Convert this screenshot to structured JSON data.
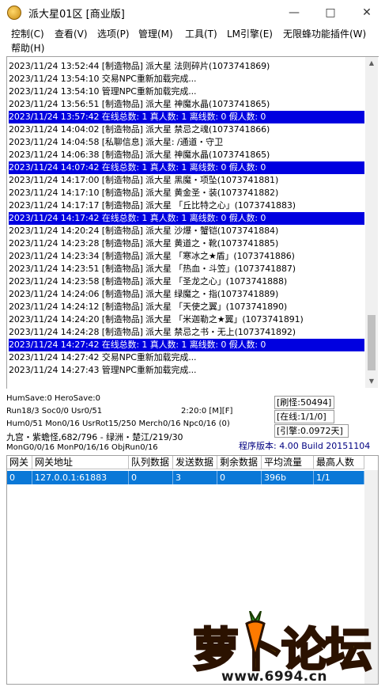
{
  "window": {
    "title": "派大星01区 [商业版]"
  },
  "menu": [
    "控制(C)",
    "查看(V)",
    "选项(P)",
    "管理(M)",
    "工具(T)",
    "LM引擎(E)",
    "无限蜂功能插件(W)",
    "帮助(H)"
  ],
  "log": [
    {
      "text": "2023/11/24 13:52:44 [制造物品] 派大星 法则碎片(1073741869)",
      "hl": false
    },
    {
      "text": "2023/11/24 13:54:10 交易NPC重新加载完成...",
      "hl": false
    },
    {
      "text": "2023/11/24 13:54:10 管理NPC重新加载完成...",
      "hl": false
    },
    {
      "text": "2023/11/24 13:56:51 [制造物品] 派大星 神魔水晶(1073741865)",
      "hl": false
    },
    {
      "text": "2023/11/24 13:57:42 在线总数: 1 真人数: 1 离线数: 0 假人数: 0",
      "hl": true
    },
    {
      "text": "2023/11/24 14:04:02 [制造物品] 派大星 禁忌之魂(1073741866)",
      "hl": false
    },
    {
      "text": "2023/11/24 14:04:58 [私聊信息] 派大星: /通道・守卫",
      "hl": false
    },
    {
      "text": "2023/11/24 14:06:38 [制造物品] 派大星 神魔水晶(1073741865)",
      "hl": false
    },
    {
      "text": "2023/11/24 14:07:42 在线总数: 1 真人数: 1 离线数: 0 假人数: 0",
      "hl": true
    },
    {
      "text": "2023/11/24 14:17:00 [制造物品] 派大星 黑魔・项坠(1073741881)",
      "hl": false
    },
    {
      "text": "2023/11/24 14:17:10 [制造物品] 派大星 黄金圣・装(1073741882)",
      "hl": false
    },
    {
      "text": "2023/11/24 14:17:17 [制造物品] 派大星 「丘比特之心」(1073741883)",
      "hl": false
    },
    {
      "text": "2023/11/24 14:17:42 在线总数: 1 真人数: 1 离线数: 0 假人数: 0",
      "hl": true
    },
    {
      "text": "2023/11/24 14:20:24 [制造物品] 派大星 沙爆・蟹铠(1073741884)",
      "hl": false
    },
    {
      "text": "2023/11/24 14:23:28 [制造物品] 派大星 黄道之・靴(1073741885)",
      "hl": false
    },
    {
      "text": "2023/11/24 14:23:34 [制造物品] 派大星 「寒冰之★盾」(1073741886)",
      "hl": false
    },
    {
      "text": "2023/11/24 14:23:51 [制造物品] 派大星 「热血・斗笠」(1073741887)",
      "hl": false
    },
    {
      "text": "2023/11/24 14:23:58 [制造物品] 派大星 「圣龙之心」(1073741888)",
      "hl": false
    },
    {
      "text": "2023/11/24 14:24:06 [制造物品] 派大星 绿魔之・指(1073741889)",
      "hl": false
    },
    {
      "text": "2023/11/24 14:24:12 [制造物品] 派大星 「天使之翼」(1073741890)",
      "hl": false
    },
    {
      "text": "2023/11/24 14:24:20 [制造物品] 派大星 「米迦勒之★翼」(1073741891)",
      "hl": false
    },
    {
      "text": "2023/11/24 14:24:28 [制造物品] 派大星 禁忌之书・无上(1073741892)",
      "hl": false
    },
    {
      "text": "2023/11/24 14:27:42 在线总数: 1 真人数: 1 离线数: 0 假人数: 0",
      "hl": true
    },
    {
      "text": "2023/11/24 14:27:42 交易NPC重新加载完成...",
      "hl": false
    },
    {
      "text": "2023/11/24 14:27:43 管理NPC重新加载完成...",
      "hl": false
    }
  ],
  "status": {
    "line1": "HumSave:0 HeroSave:0",
    "line2": "Run18/3 Soc0/0 Usr0/51",
    "line2b": "2:20:0 [M][F]",
    "line3": "Hum0/51 Mon0/16 UsrRot15/250 Merch0/16 Npc0/16 (0)",
    "line4": "九宫・紫蟾怪,682/796 - 绿洲・楚江/219/30",
    "line5": "MonG0/0/16 MonP0/16/16 ObjRun0/16",
    "refresh": "[刷怪:50494]",
    "online": "[在线:1/1/0]",
    "engine": "[引擎:0.0972天]",
    "version": "程序版本: 4.00 Build 20151104"
  },
  "table": {
    "headers": [
      "网关",
      "网关地址",
      "队列数据",
      "发送数据",
      "剩余数据",
      "平均流量",
      "最高人数"
    ],
    "rows": [
      [
        "0",
        "127.0.0.1:61883",
        "0",
        "3",
        "0",
        "396b",
        "1/1"
      ]
    ]
  },
  "watermark": {
    "text": "萝卜论坛",
    "url": "www.6994.cn"
  },
  "icons": {
    "app": "app-icon",
    "min": "minimize-icon",
    "max": "maximize-icon",
    "close": "close-icon"
  },
  "colors": {
    "highlight": "#0000e0",
    "selection": "#0a78d7",
    "watermark": "#ffd200"
  }
}
